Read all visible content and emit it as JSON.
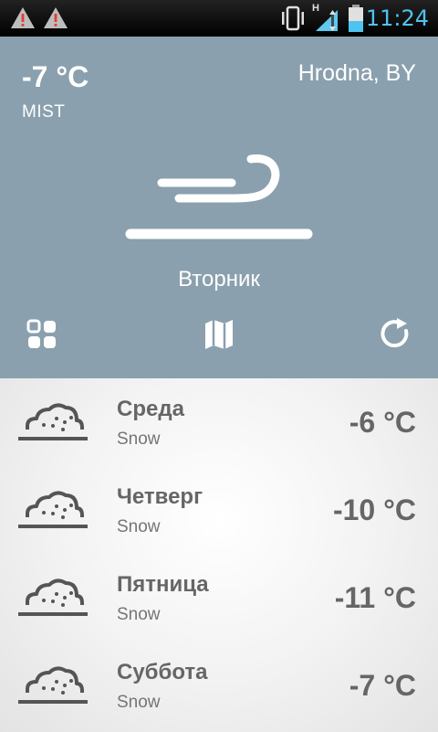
{
  "status_bar": {
    "time": "11:24",
    "network_letter": "H",
    "icons": [
      "warning-icon",
      "warning-icon",
      "vibrate-icon",
      "signal-icon",
      "battery-icon"
    ]
  },
  "current": {
    "temperature": "-7 °C",
    "description": "MIST",
    "city": "Hrodna, BY",
    "day": "Вторник",
    "icon": "wind-icon"
  },
  "actions": [
    "grid-icon",
    "map-icon",
    "refresh-icon"
  ],
  "forecast": [
    {
      "day": "Среда",
      "condition": "Snow",
      "temp": "-6 °C",
      "icon": "snow-cloud-icon"
    },
    {
      "day": "Четверг",
      "condition": "Snow",
      "temp": "-10 °C",
      "icon": "snow-cloud-icon"
    },
    {
      "day": "Пятница",
      "condition": "Snow",
      "temp": "-11 °C",
      "icon": "snow-cloud-icon"
    },
    {
      "day": "Суббота",
      "condition": "Snow",
      "temp": "-7 °C",
      "icon": "snow-cloud-icon"
    }
  ],
  "colors": {
    "header_bg": "#8aa0ae",
    "status_accent": "#4fc3f0",
    "warning_red": "#e53935",
    "list_text": "#666666"
  }
}
